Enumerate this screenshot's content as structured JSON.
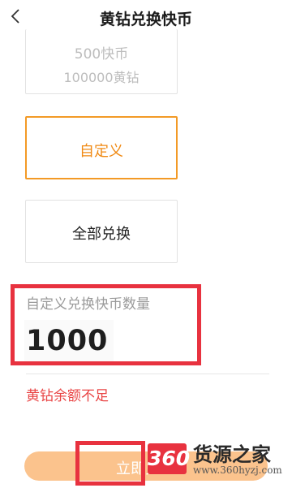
{
  "header": {
    "title": "黄钻兑换快币",
    "back_icon": "chevron-left-icon"
  },
  "options": {
    "option_500": {
      "coins": "500快币",
      "cost": "100000黄钻"
    },
    "custom_label": "自定义",
    "all_label": "全部兑换"
  },
  "custom_amount": {
    "label": "自定义兑换快币数量",
    "value": "1000",
    "error": "黄钻余额不足"
  },
  "submit": {
    "label": "立即兑换"
  },
  "watermark": {
    "logo": "360",
    "name": "货源之家",
    "url": "www.360hyzj.com"
  },
  "colors": {
    "accent_orange": "#f39a26",
    "button_orange": "#fbc38d",
    "error_red": "#e94545",
    "annotation_red": "#e8323f"
  }
}
